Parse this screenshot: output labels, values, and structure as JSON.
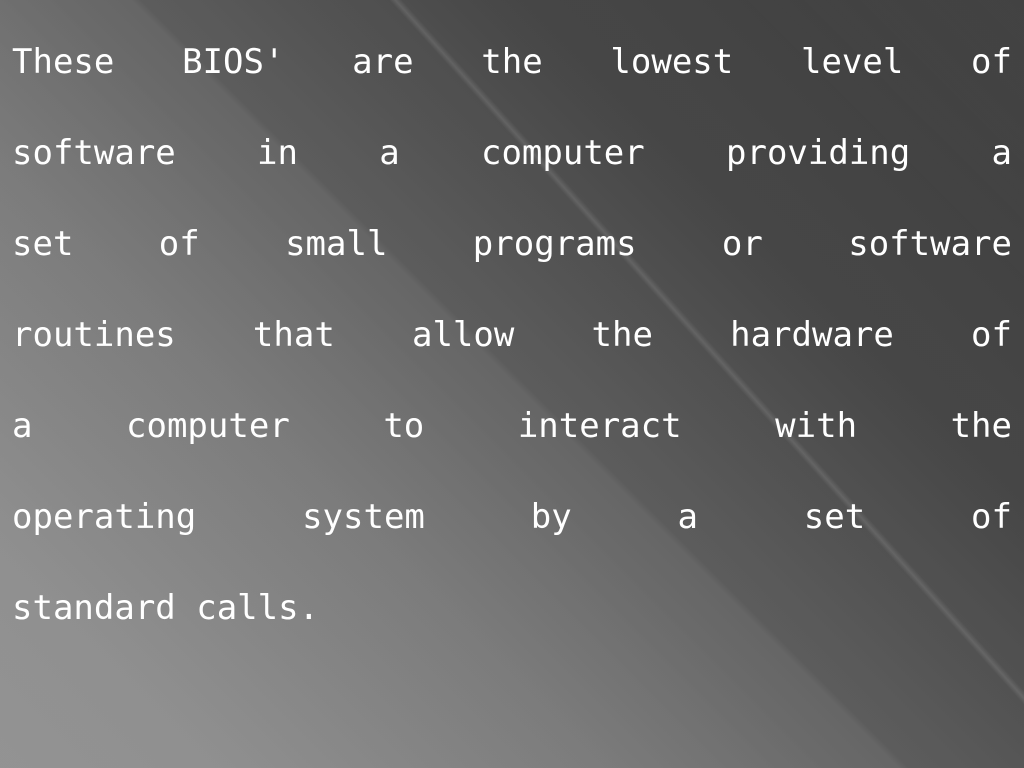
{
  "slide": {
    "background": {
      "style": "diagonal-gray-gradient",
      "color_dark": "#434343",
      "color_mid": "#6f6f6f",
      "color_light": "#8e8e8e",
      "accent_hairline": "#bdbdbd"
    },
    "text_color": "#ffffff",
    "alignment": "justified",
    "body": {
      "lines": [
        "These BIOS' are the lowest level of",
        "software in a computer providing a",
        "set of small programs or software",
        "routines that allow the hardware of",
        "a computer to interact with the",
        "operating system by a set of",
        "standard calls."
      ],
      "full_text": "These BIOS' are the lowest level of software in a computer providing a set of small programs or software routines that allow the hardware of a computer to interact with the operating system by a set of standard calls."
    }
  }
}
